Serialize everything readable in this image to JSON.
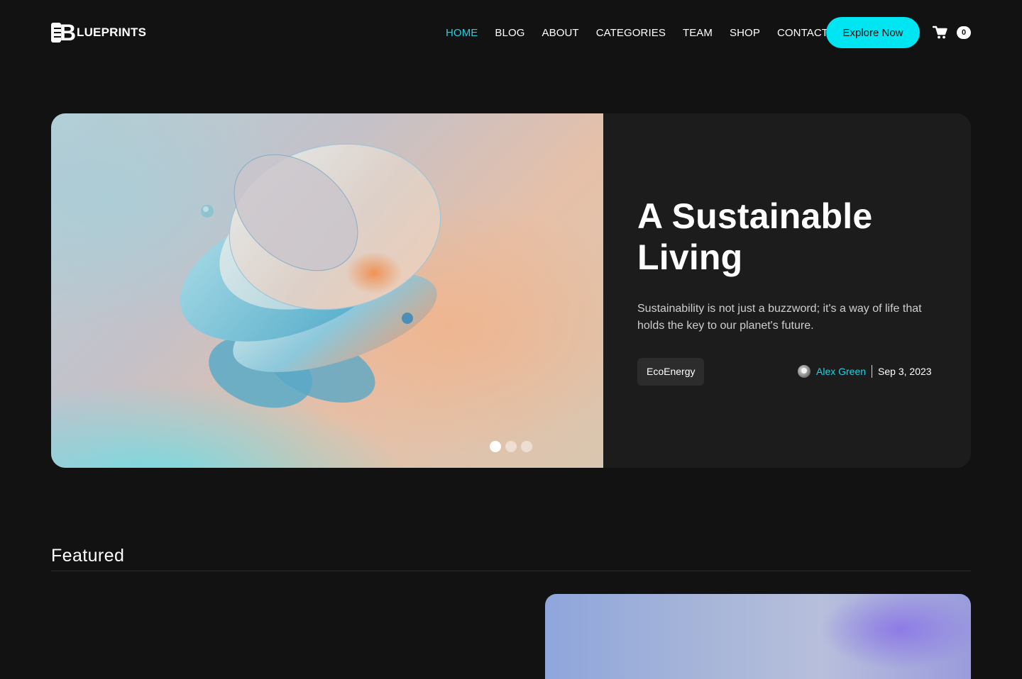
{
  "brand": {
    "logo_text": "LUEPRINTS",
    "logo_letter": "B"
  },
  "nav": {
    "items": [
      {
        "label": "HOME",
        "active": true
      },
      {
        "label": "BLOG",
        "active": false
      },
      {
        "label": "ABOUT",
        "active": false
      },
      {
        "label": "CATEGORIES",
        "active": false
      },
      {
        "label": "TEAM",
        "active": false
      },
      {
        "label": "SHOP",
        "active": false
      },
      {
        "label": "CONTACT",
        "active": false
      }
    ],
    "cta_label": "Explore Now",
    "cart_count": "0",
    "cart_icon": "shopping-cart-icon"
  },
  "hero": {
    "title": "A Sustainable Living",
    "description": "Sustainability is not just a buzzword; it's a way of life that holds the key to our planet's future.",
    "tag": "EcoEnergy",
    "author": "Alex Green",
    "date": "Sep 3, 2023",
    "slides_total": 3,
    "active_slide": 1
  },
  "featured": {
    "title": "Featured"
  },
  "colors": {
    "background": "#121212",
    "accent": "#00e5f2",
    "accent_text": "#1fd1e3",
    "card": "#1c1c1c",
    "tag_bg": "#2c2c2c"
  }
}
